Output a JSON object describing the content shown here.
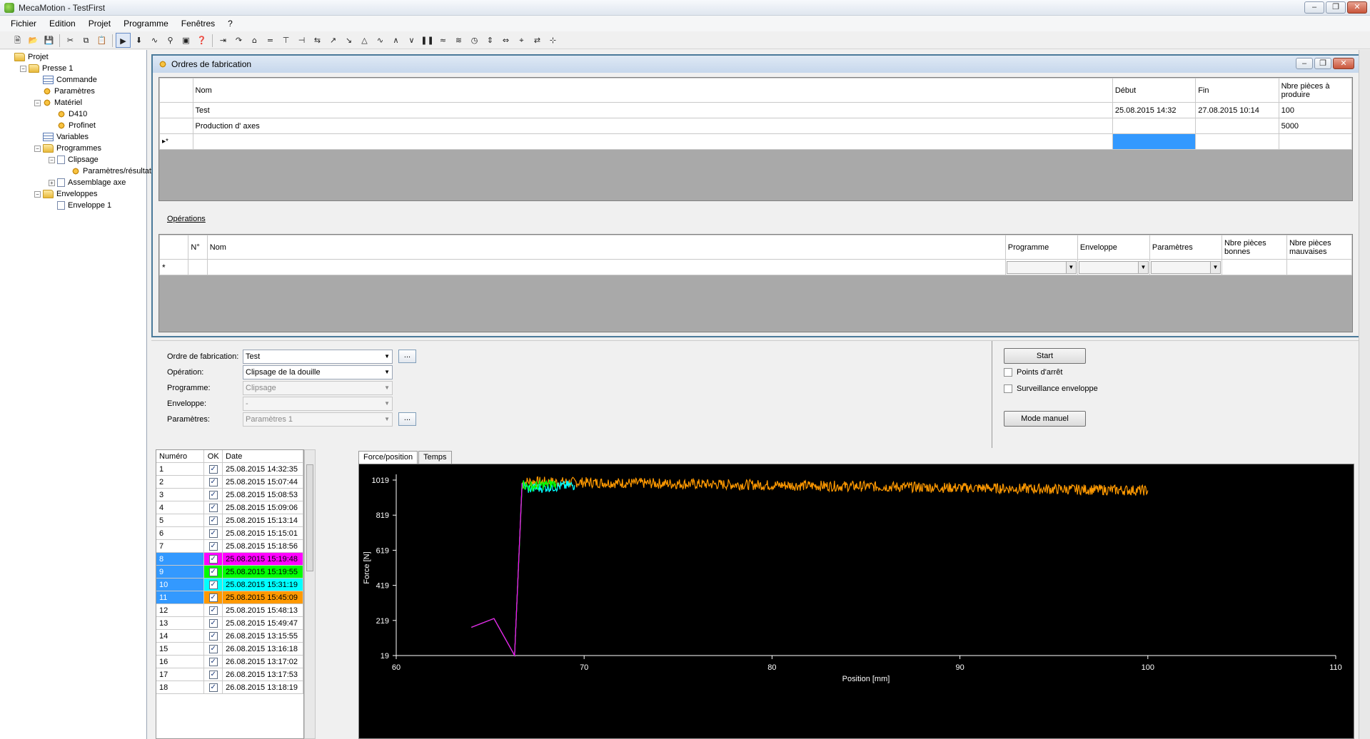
{
  "window": {
    "title": "MecaMotion - TestFirst"
  },
  "menu": [
    "Fichier",
    "Edition",
    "Projet",
    "Programme",
    "Fenêtres",
    "?"
  ],
  "tree": [
    {
      "label": "Projet",
      "level": 0,
      "icon": "folder",
      "expander": ""
    },
    {
      "label": "Presse 1",
      "level": 1,
      "icon": "folder",
      "expander": "−"
    },
    {
      "label": "Commande",
      "level": 2,
      "icon": "grid",
      "expander": ""
    },
    {
      "label": "Paramètres",
      "level": 2,
      "icon": "gear",
      "expander": ""
    },
    {
      "label": "Matériel",
      "level": 2,
      "icon": "gear",
      "expander": "−"
    },
    {
      "label": "D410",
      "level": 3,
      "icon": "gear",
      "expander": ""
    },
    {
      "label": "Profinet",
      "level": 3,
      "icon": "gear",
      "expander": ""
    },
    {
      "label": "Variables",
      "level": 2,
      "icon": "grid",
      "expander": ""
    },
    {
      "label": "Programmes",
      "level": 2,
      "icon": "folder",
      "expander": "−"
    },
    {
      "label": "Clipsage",
      "level": 3,
      "icon": "doc",
      "expander": "−"
    },
    {
      "label": "Paramètres/résultats",
      "level": 4,
      "icon": "gear",
      "expander": ""
    },
    {
      "label": "Assemblage axe",
      "level": 3,
      "icon": "doc",
      "expander": "+"
    },
    {
      "label": "Enveloppes",
      "level": 2,
      "icon": "folder",
      "expander": "−"
    },
    {
      "label": "Enveloppe 1",
      "level": 3,
      "icon": "doc",
      "expander": ""
    }
  ],
  "orders_window": {
    "title": "Ordres de fabrication",
    "columns": [
      "Nom",
      "Début",
      "Fin",
      "Nbre pièces à produire"
    ],
    "rows": [
      {
        "nom": "Test",
        "debut": "25.08.2015 14:32",
        "fin": "27.08.2015 10:14",
        "nbre": "100"
      },
      {
        "nom": "Production d' axes",
        "debut": "",
        "fin": "",
        "nbre": "5000"
      }
    ],
    "new_row_marker": "▸*",
    "operations_label": "Opérations",
    "op_columns": [
      "N°",
      "Nom",
      "Programme",
      "Enveloppe",
      "Paramètres",
      "Nbre pièces bonnes",
      "Nbre pièces mauvaises"
    ],
    "op_new_marker": "*"
  },
  "form": {
    "ordre_label": "Ordre de fabrication:",
    "ordre_value": "Test",
    "operation_label": "Opération:",
    "operation_value": "Clipsage de la douille",
    "programme_label": "Programme:",
    "programme_value": "Clipsage",
    "enveloppe_label": "Enveloppe:",
    "enveloppe_value": "-",
    "parametres_label": "Paramètres:",
    "parametres_value": "Paramètres 1",
    "dots": "..."
  },
  "controls": {
    "start": "Start",
    "points_arret": "Points d'arrêt",
    "surveillance": "Surveillance enveloppe",
    "mode_manuel": "Mode manuel"
  },
  "results": {
    "columns": [
      "Numéro",
      "OK",
      "Date"
    ],
    "rows": [
      {
        "num": "1",
        "ok": true,
        "date": "25.08.2015 14:32:35",
        "color": ""
      },
      {
        "num": "2",
        "ok": true,
        "date": "25.08.2015 15:07:44",
        "color": ""
      },
      {
        "num": "3",
        "ok": true,
        "date": "25.08.2015 15:08:53",
        "color": ""
      },
      {
        "num": "4",
        "ok": true,
        "date": "25.08.2015 15:09:06",
        "color": ""
      },
      {
        "num": "5",
        "ok": true,
        "date": "25.08.2015 15:13:14",
        "color": ""
      },
      {
        "num": "6",
        "ok": true,
        "date": "25.08.2015 15:15:01",
        "color": ""
      },
      {
        "num": "7",
        "ok": true,
        "date": "25.08.2015 15:18:56",
        "color": ""
      },
      {
        "num": "8",
        "ok": true,
        "date": "25.08.2015 15:19:48",
        "color": "#ff00ff"
      },
      {
        "num": "9",
        "ok": true,
        "date": "25.08.2015 15:19:55",
        "color": "#00ff00"
      },
      {
        "num": "10",
        "ok": true,
        "date": "25.08.2015 15:31:19",
        "color": "#00ffff"
      },
      {
        "num": "11",
        "ok": true,
        "date": "25.08.2015 15:45:09",
        "color": "#ff9900"
      },
      {
        "num": "12",
        "ok": true,
        "date": "25.08.2015 15:48:13",
        "color": ""
      },
      {
        "num": "13",
        "ok": true,
        "date": "25.08.2015 15:49:47",
        "color": ""
      },
      {
        "num": "14",
        "ok": true,
        "date": "26.08.2015 13:15:55",
        "color": ""
      },
      {
        "num": "15",
        "ok": true,
        "date": "26.08.2015 13:16:18",
        "color": ""
      },
      {
        "num": "16",
        "ok": true,
        "date": "26.08.2015 13:17:02",
        "color": ""
      },
      {
        "num": "17",
        "ok": true,
        "date": "26.08.2015 13:17:53",
        "color": ""
      },
      {
        "num": "18",
        "ok": true,
        "date": "26.08.2015 13:18:19",
        "color": ""
      }
    ],
    "selected_num_color": "#3399ff"
  },
  "tabs": [
    "Force/position",
    "Temps"
  ],
  "chart_data": {
    "type": "line",
    "xlabel": "Position [mm]",
    "ylabel": "Force [N]",
    "xlim": [
      60,
      110
    ],
    "ylim": [
      19,
      1019
    ],
    "xticks": [
      60,
      70,
      80,
      90,
      100,
      110
    ],
    "yticks": [
      19,
      219,
      419,
      619,
      819,
      1019
    ],
    "background": "#000000",
    "series": [
      {
        "color": "#ff9900",
        "x": [
          64.0,
          65.2,
          66.3,
          66.7,
          67,
          100
        ],
        "y": [
          180,
          230,
          20,
          1000,
          1010,
          960
        ],
        "noisy_from": 66.7
      },
      {
        "color": "#00ffff",
        "x": [
          64.0,
          65.2,
          66.3,
          66.7,
          67,
          69.5
        ],
        "y": [
          180,
          230,
          20,
          1000,
          970,
          990
        ],
        "noisy_from": 66.7
      },
      {
        "color": "#00ff00",
        "x": [
          64.0,
          65.2,
          66.3,
          66.7,
          67,
          68.5
        ],
        "y": [
          180,
          230,
          20,
          1000,
          980,
          1000
        ],
        "noisy_from": 66.7
      },
      {
        "color": "#ff00ff",
        "x": [
          64.0,
          65.2,
          66.3,
          66.7
        ],
        "y": [
          180,
          230,
          20,
          1000
        ],
        "noisy_from": 999
      }
    ]
  }
}
